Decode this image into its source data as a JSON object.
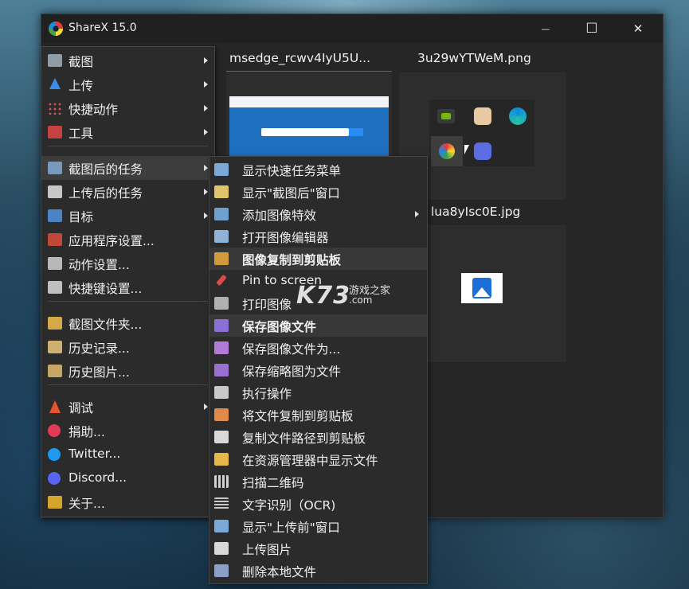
{
  "window": {
    "title": "ShareX 15.0",
    "minimize": "—",
    "maximize": "☐",
    "close": "✕"
  },
  "thumbnails": [
    {
      "title": "msedge_rcwv4IyU5U..."
    },
    {
      "title": "3u29wYTWeM.png"
    },
    {
      "title": "lua8yIsc0E.jpg"
    }
  ],
  "main_menu": [
    {
      "label": "截图",
      "icon": "capture-icon",
      "submenu": true
    },
    {
      "label": "上传",
      "icon": "upload-arrow-icon",
      "submenu": true
    },
    {
      "label": "快捷动作",
      "icon": "grid-dots-icon",
      "submenu": true
    },
    {
      "label": "工具",
      "icon": "toolbox-icon",
      "submenu": true
    },
    {
      "label": "截图后的任务",
      "icon": "after-capture-icon",
      "submenu": true
    },
    {
      "label": "上传后的任务",
      "icon": "cloud-upload-icon",
      "submenu": true
    },
    {
      "label": "目标",
      "icon": "destination-icon",
      "submenu": true
    },
    {
      "label": "应用程序设置...",
      "icon": "wrench-icon",
      "submenu": false
    },
    {
      "label": "动作设置...",
      "icon": "gear-icon",
      "submenu": false
    },
    {
      "label": "快捷键设置...",
      "icon": "keyboard-icon",
      "submenu": false
    },
    {
      "label": "截图文件夹...",
      "icon": "folder-icon",
      "submenu": false
    },
    {
      "label": "历史记录...",
      "icon": "history-icon",
      "submenu": false
    },
    {
      "label": "历史图片...",
      "icon": "image-history-icon",
      "submenu": false
    },
    {
      "label": "调试",
      "icon": "debug-cone-icon",
      "submenu": true
    },
    {
      "label": "捐助...",
      "icon": "heart-icon",
      "submenu": false
    },
    {
      "label": "Twitter...",
      "icon": "twitter-icon",
      "submenu": false
    },
    {
      "label": "Discord...",
      "icon": "discord-icon",
      "submenu": false
    },
    {
      "label": "关于...",
      "icon": "crown-icon",
      "submenu": false
    }
  ],
  "after_capture_menu": [
    {
      "label": "显示快速任务菜单",
      "icon": "quick-menu-icon",
      "bold": false,
      "submenu": false
    },
    {
      "label": "显示\"截图后\"窗口",
      "icon": "window-icon",
      "bold": false,
      "submenu": false
    },
    {
      "label": "添加图像特效",
      "icon": "image-effects-icon",
      "bold": false,
      "submenu": true
    },
    {
      "label": "打开图像编辑器",
      "icon": "image-editor-icon",
      "bold": false,
      "submenu": false
    },
    {
      "label": "图像复制到剪贴板",
      "icon": "clipboard-image-icon",
      "bold": true,
      "submenu": false
    },
    {
      "label": "Pin to screen",
      "icon": "pin-icon",
      "bold": false,
      "submenu": false
    },
    {
      "label": "打印图像",
      "icon": "printer-icon",
      "bold": false,
      "submenu": false
    },
    {
      "label": "保存图像文件",
      "icon": "save-icon",
      "bold": true,
      "submenu": false
    },
    {
      "label": "保存图像文件为...",
      "icon": "save-as-icon",
      "bold": false,
      "submenu": false
    },
    {
      "label": "保存缩略图为文件",
      "icon": "thumbnail-save-icon",
      "bold": false,
      "submenu": false
    },
    {
      "label": "执行操作",
      "icon": "console-icon",
      "bold": false,
      "submenu": false
    },
    {
      "label": "将文件复制到剪贴板",
      "icon": "clipboard-file-icon",
      "bold": false,
      "submenu": false
    },
    {
      "label": "复制文件路径到剪贴板",
      "icon": "clipboard-path-icon",
      "bold": false,
      "submenu": false
    },
    {
      "label": "在资源管理器中显示文件",
      "icon": "explorer-folder-icon",
      "bold": false,
      "submenu": false
    },
    {
      "label": "扫描二维码",
      "icon": "qr-code-icon",
      "bold": false,
      "submenu": false
    },
    {
      "label": "文字识别（OCR)",
      "icon": "ocr-text-icon",
      "bold": false,
      "submenu": false
    },
    {
      "label": "显示\"上传前\"窗口",
      "icon": "before-upload-icon",
      "bold": false,
      "submenu": false
    },
    {
      "label": "上传图片",
      "icon": "cloud-upload-icon",
      "bold": false,
      "submenu": false
    },
    {
      "label": "删除本地文件",
      "icon": "delete-file-icon",
      "bold": false,
      "submenu": false
    }
  ],
  "watermark": {
    "brand": "K73",
    "cn": "游戏之家",
    "domain": ".com"
  }
}
